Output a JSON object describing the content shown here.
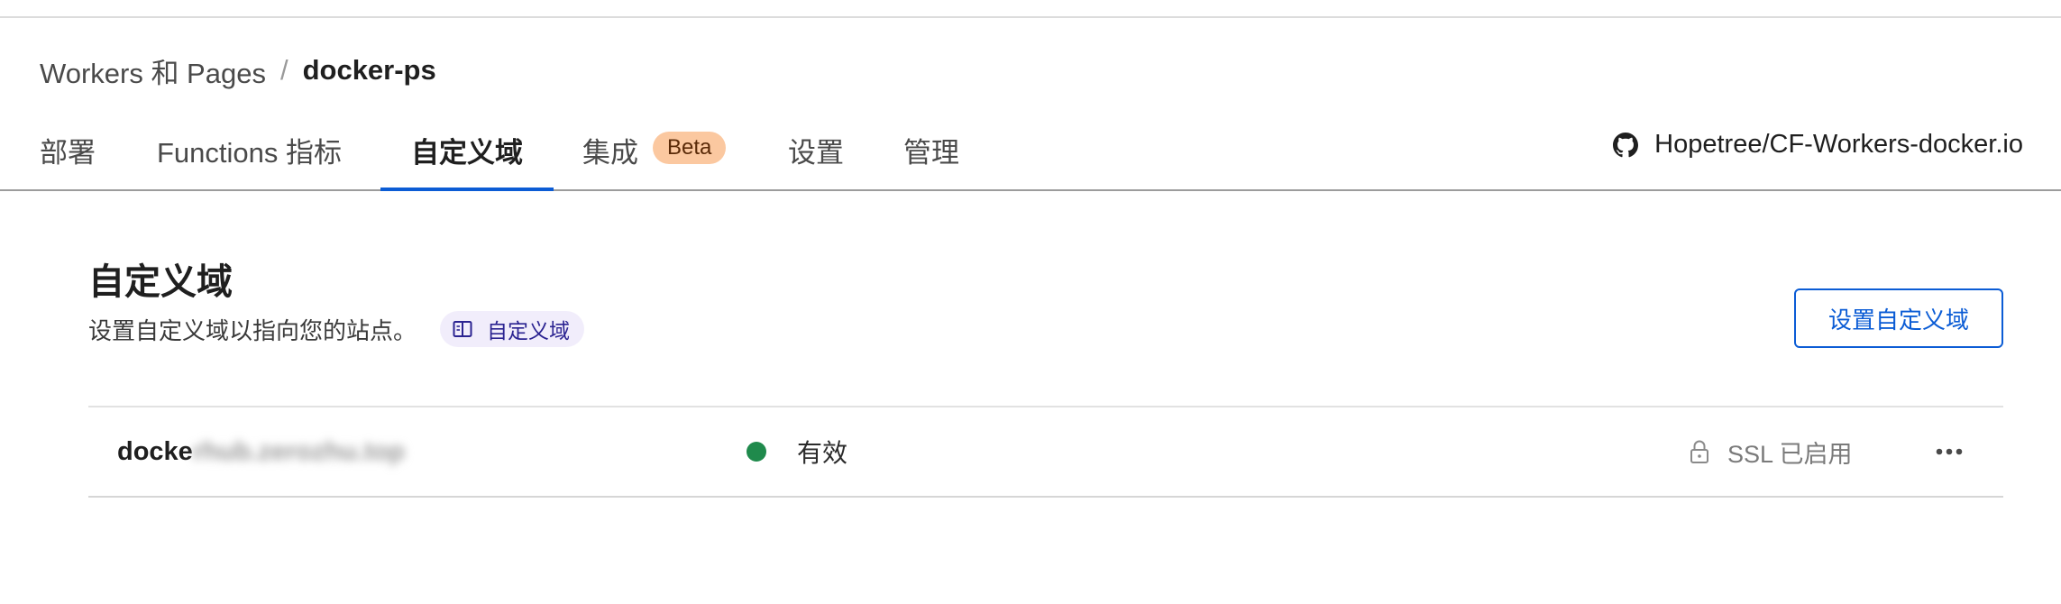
{
  "breadcrumb": {
    "parent": "Workers 和 Pages",
    "separator": "/",
    "current": "docker-ps"
  },
  "tabs": [
    {
      "label": "部署",
      "active": false
    },
    {
      "label": "Functions 指标",
      "active": false
    },
    {
      "label": "自定义域",
      "active": true
    },
    {
      "label": "集成",
      "badge": "Beta",
      "active": false
    },
    {
      "label": "设置",
      "active": false
    },
    {
      "label": "管理",
      "active": false
    }
  ],
  "repo": {
    "icon": "github-icon",
    "label": "Hopetree/CF-Workers-docker.io"
  },
  "section": {
    "title": "自定义域",
    "description": "设置自定义域以指向您的站点。",
    "doc_link": {
      "icon": "book-icon",
      "label": "自定义域"
    },
    "setup_button": "设置自定义域"
  },
  "domains": [
    {
      "name_visible": "docke",
      "name_redacted": "rhub.zerozhu.top",
      "status": "有效",
      "status_color": "#1f8a4c",
      "ssl_icon": "lock-icon",
      "ssl": "SSL 已启用",
      "menu_icon": "more-icon"
    }
  ],
  "colors": {
    "accent": "#0b5cd5",
    "beta_badge_bg": "#fbc8a0",
    "doc_chip_bg": "#f1edfb"
  }
}
